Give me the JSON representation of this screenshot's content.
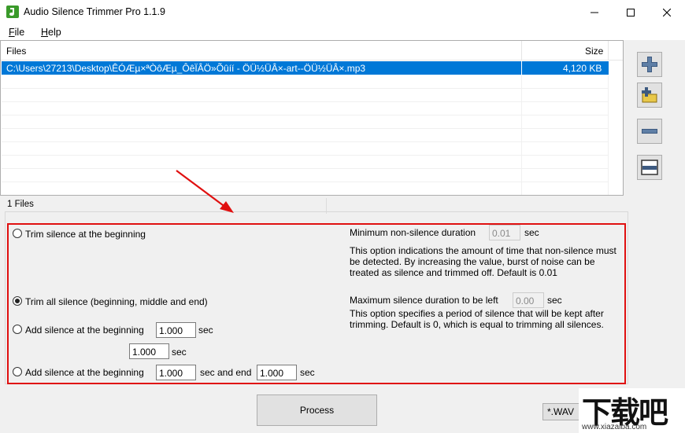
{
  "window": {
    "title": "Audio Silence Trimmer Pro 1.1.9"
  },
  "menu": {
    "file": "File",
    "file_mnemonic": "F",
    "file_rest": "ile",
    "help": "Help",
    "help_mnemonic": "H",
    "help_rest": "elp"
  },
  "file_list": {
    "columns": {
      "files": "Files",
      "size": "Size"
    },
    "rows": [
      {
        "path": "C:\\Users\\27213\\Desktop\\ÊÓÆµ×ªÒôÆµ_ÔêÏÂÖ»Õûíí - ÖÜ½ÜÂ×-art--ÖÜ½ÜÂ×.mp3",
        "size": "4,120 KB"
      }
    ]
  },
  "side_buttons": [
    "add-file-icon",
    "add-folder-icon",
    "remove-icon",
    "clear-icon"
  ],
  "status": {
    "count": "1 Files"
  },
  "options": {
    "trim_beginning": "Trim silence at the beginning",
    "trim_all": "Trim all silence (beginning, middle and end)",
    "add_beginning": "Add silence at the beginning",
    "add_beginning_value": "1.000",
    "add_beginning_unit": "sec",
    "add_end_value": "1.000",
    "add_end_unit": "sec",
    "add_both": "Add silence at the beginning",
    "add_both_begin_value": "1.000",
    "add_both_mid": "sec and end",
    "add_both_end_value": "1.000",
    "add_both_unit": "sec",
    "selected": "trim_all"
  },
  "settings": {
    "min_nonsilence_label": "Minimum non-silence duration",
    "min_nonsilence_value": "0.01",
    "min_nonsilence_unit": "sec",
    "min_nonsilence_desc": "This option indications the amount of time that non-silence must be detected. By increasing the value, burst of noise can be treated as silence and trimmed off. Default is 0.01",
    "max_silence_label": "Maximum silence duration to be left",
    "max_silence_value": "0.00",
    "max_silence_unit": "sec",
    "max_silence_desc": "This option specifies a period of silence that will be kept after trimming. Default is 0, which is equal to trimming all silences."
  },
  "actions": {
    "process": "Process",
    "format": "*.WAV"
  },
  "watermark": {
    "logo": "下载吧",
    "url": "www.xiazaiba.com"
  },
  "colors": {
    "selection": "#0078d7",
    "highlight_box": "#e01010",
    "annotation_arrow": "#e01010"
  }
}
